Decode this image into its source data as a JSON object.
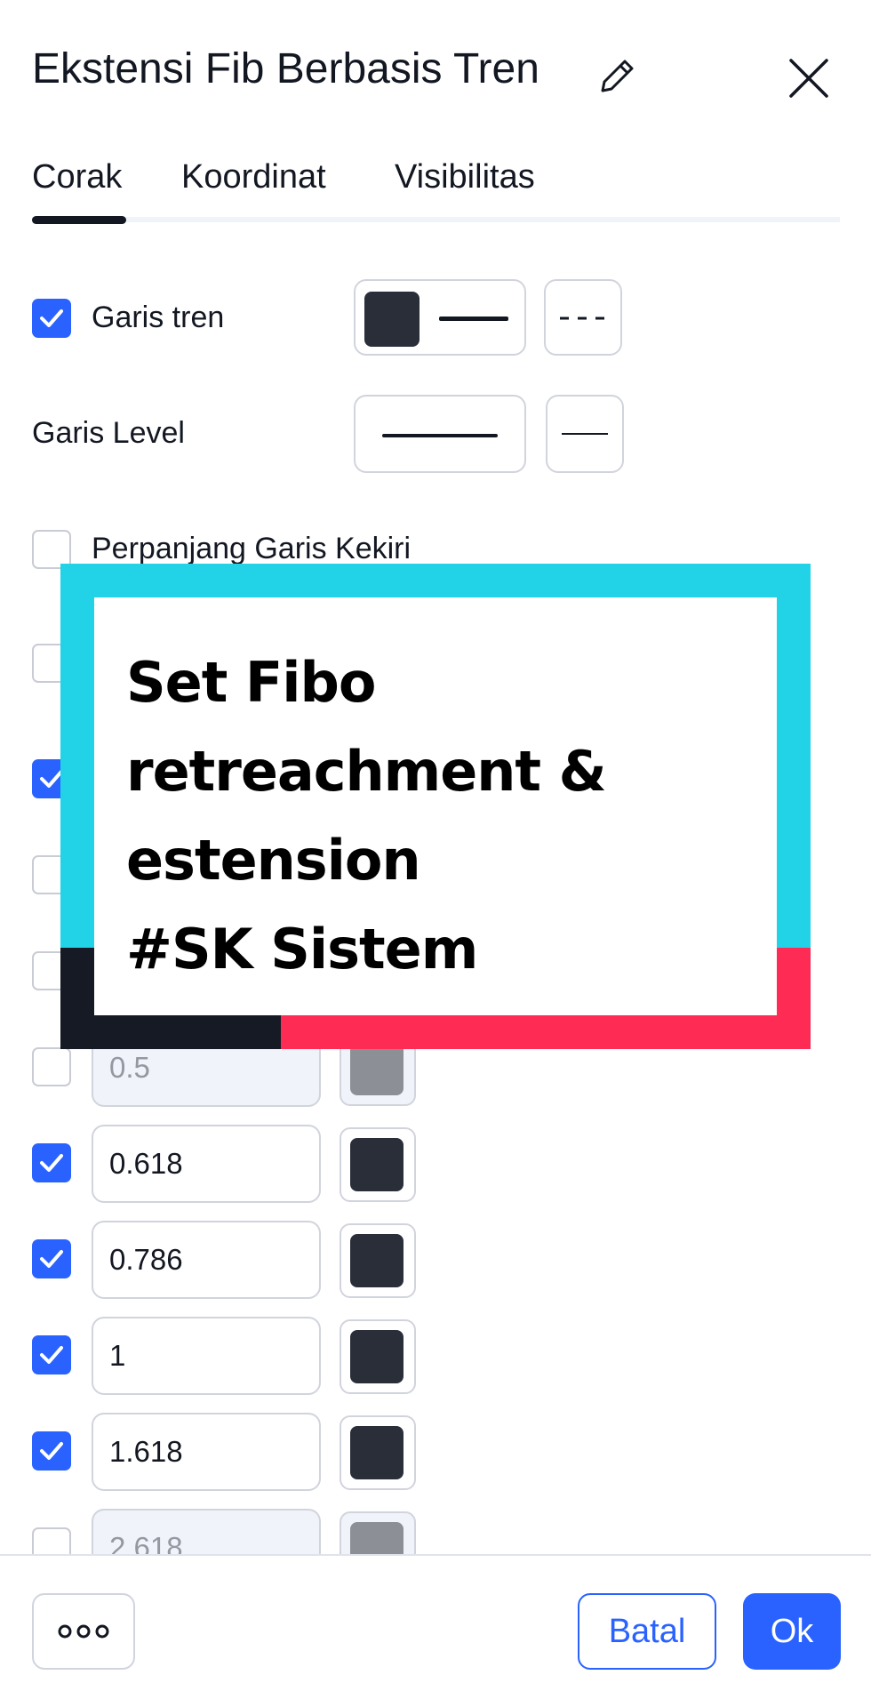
{
  "header": {
    "title": "Ekstensi Fib Berbasis Tren"
  },
  "tabs": [
    {
      "label": "Corak",
      "active": true
    },
    {
      "label": "Koordinat",
      "active": false
    },
    {
      "label": "Visibilitas",
      "active": false
    }
  ],
  "style": {
    "trend_line": {
      "label": "Garis tren",
      "checked": true
    },
    "level_lines": {
      "label": "Garis Level"
    },
    "extend_left": {
      "label": "Perpanjang Garis Kekiri",
      "checked": false
    }
  },
  "levels": [
    {
      "value": "0.5",
      "checked": false
    },
    {
      "value": "0.618",
      "checked": true
    },
    {
      "value": "0.786",
      "checked": true
    },
    {
      "value": "1",
      "checked": true
    },
    {
      "value": "1.618",
      "checked": true
    },
    {
      "value": "2.618",
      "checked": false
    }
  ],
  "overlay": {
    "lines": [
      "Set Fibo",
      "retreachment &",
      "estension",
      "#SK Sistem"
    ]
  },
  "footer": {
    "cancel_label": "Batal",
    "ok_label": "Ok"
  },
  "colors": {
    "accent": "#2962ff",
    "swatch": "#2a2e39",
    "overlay_cyan": "#22d3e8",
    "overlay_red": "#fe2c55",
    "overlay_dark": "#161a25"
  },
  "icons": {
    "edit": "pencil-icon",
    "close": "close-icon",
    "more": "more-icon",
    "check": "check-icon"
  }
}
